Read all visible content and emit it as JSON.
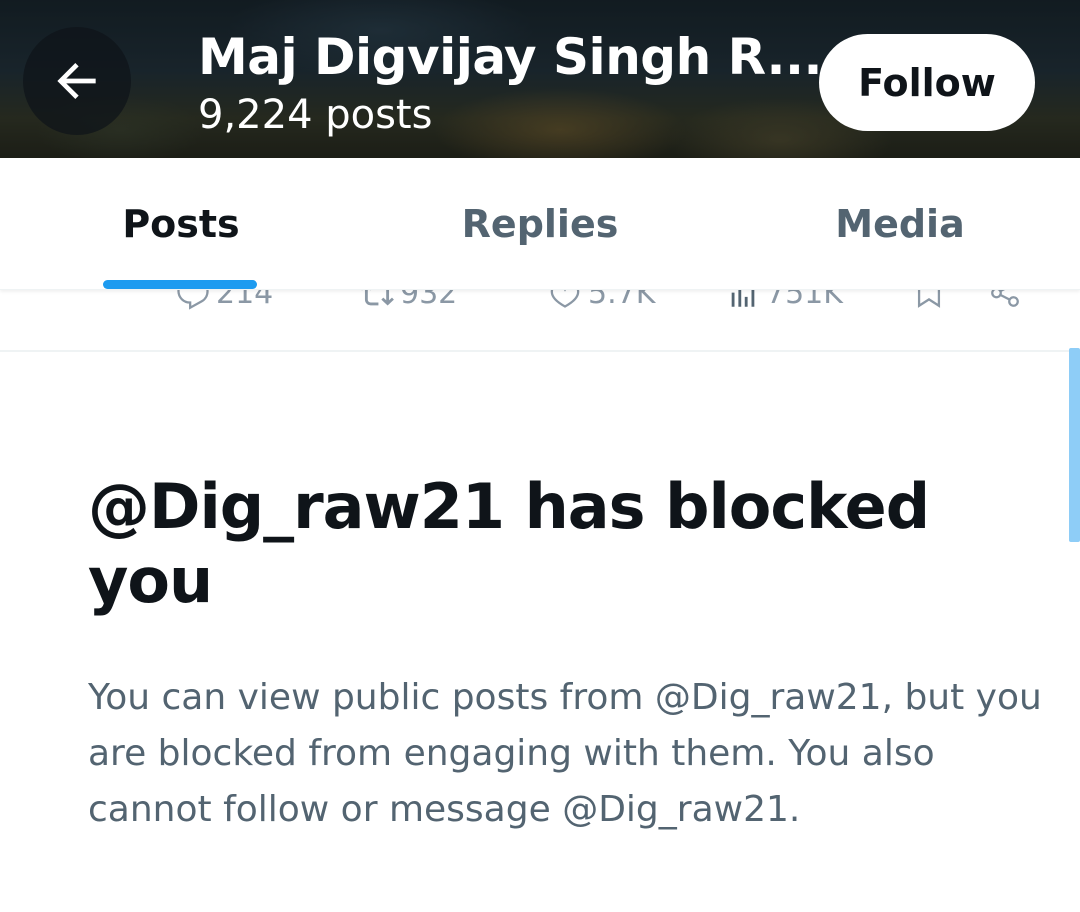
{
  "header": {
    "title": "Maj Digvijay Singh R...",
    "posts_count": "9,224 posts",
    "follow_label": "Follow",
    "back_icon": "arrow-left-icon"
  },
  "tabs": [
    {
      "label": "Posts",
      "active": true
    },
    {
      "label": "Replies",
      "active": false
    },
    {
      "label": "Media",
      "active": false
    }
  ],
  "post_actions": {
    "replies": "214",
    "reposts": "932",
    "likes": "5.7K",
    "views": "751K"
  },
  "blocked": {
    "title": "@Dig_raw21 has blocked you",
    "message": "You can view public posts from @Dig_raw21, but you are blocked from engaging with them. You also cannot follow or message @Dig_raw21."
  },
  "colors": {
    "accent": "#1d9bf0",
    "text_primary": "#0f1419",
    "text_secondary": "#536471"
  }
}
